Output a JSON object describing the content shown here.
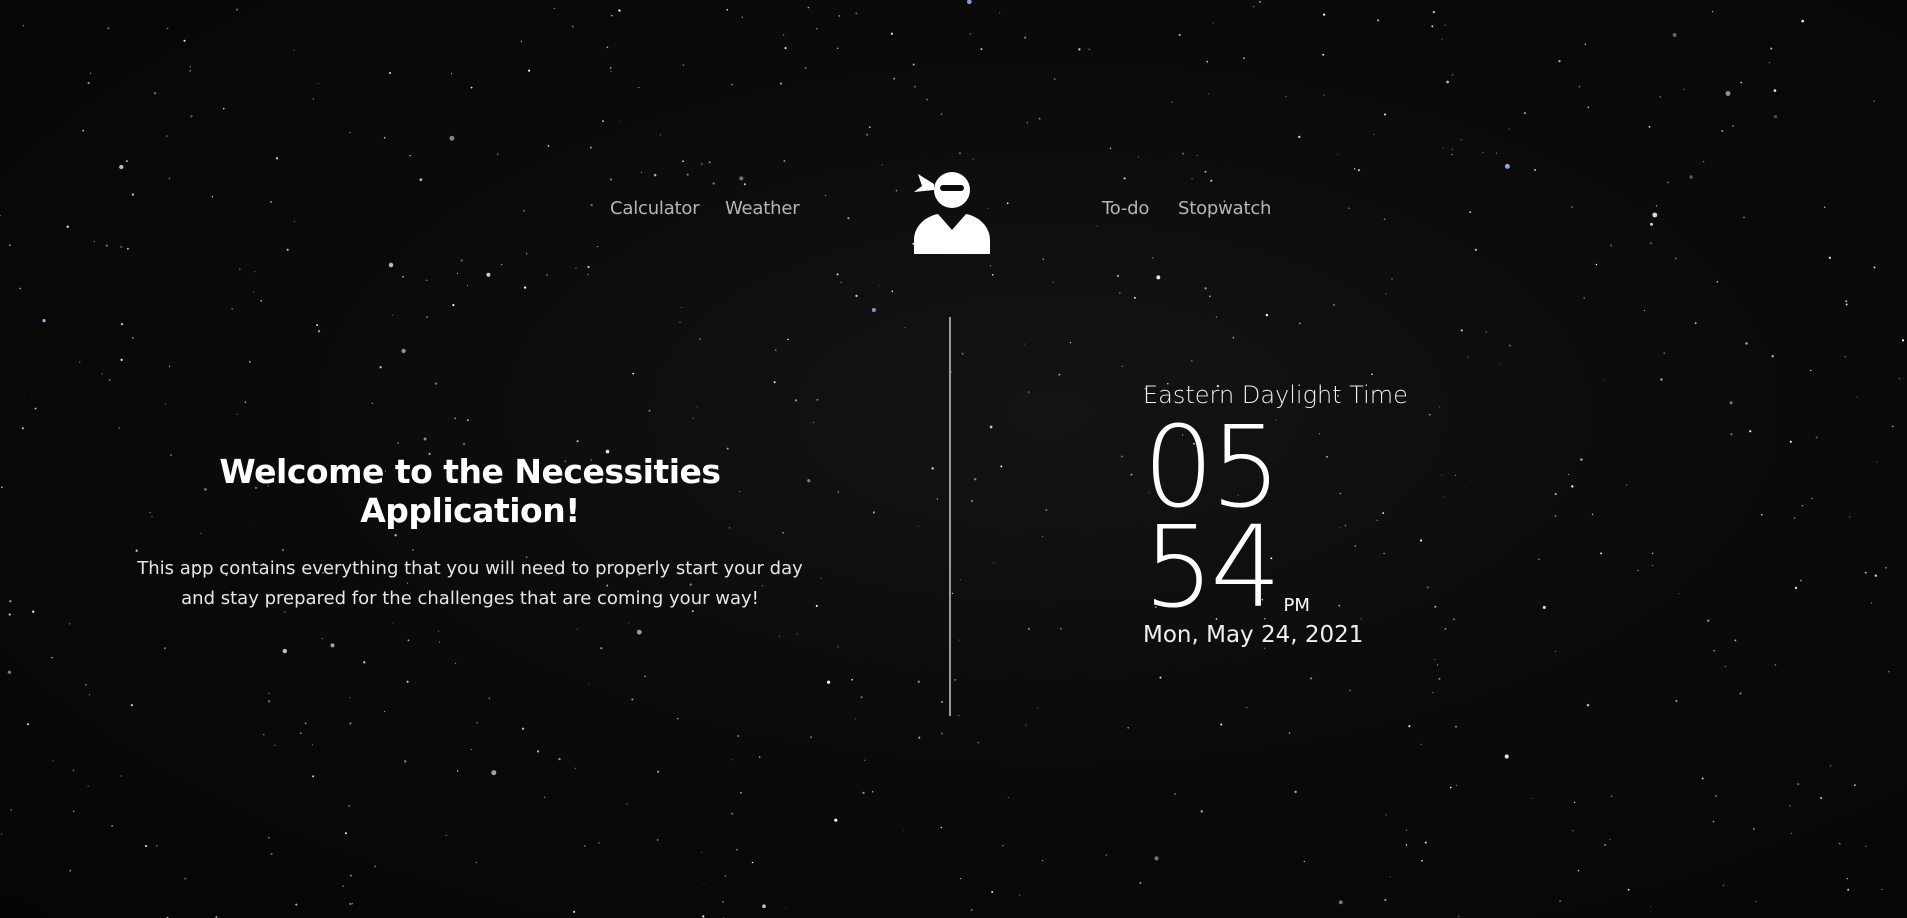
{
  "nav": {
    "left": [
      "Calculator",
      "Weather"
    ],
    "right": [
      "To-do",
      "Stopwatch"
    ],
    "logo_icon": "ninja-avatar-icon"
  },
  "welcome": {
    "title": "Welcome to the Necessities Application!",
    "description": "This app contains everything that you will need to properly start your day and stay prepared for the challenges that are coming your way!"
  },
  "clock": {
    "timezone": "Eastern Daylight Time",
    "hours": "05",
    "minutes": "54",
    "ampm": "PM",
    "date": "Mon, May 24, 2021"
  },
  "colors": {
    "background": "#0b0b0b",
    "nav_text": "#b5b5b5",
    "text": "#ffffff",
    "divider": "#9a9a9a"
  }
}
